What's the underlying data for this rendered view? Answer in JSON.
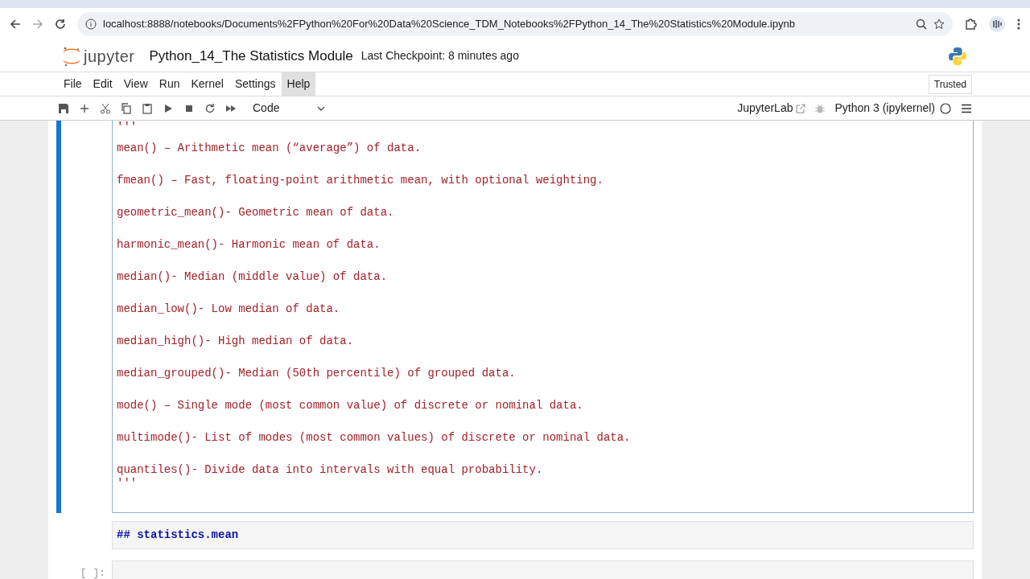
{
  "browser": {
    "url": "localhost:8888/notebooks/Documents%2FPython%20For%20Data%20Science_TDM_Notebooks%2FPython_14_The%20Statistics%20Module.ipynb"
  },
  "header": {
    "logo_text": "jupyter",
    "notebook_title": "Python_14_The Statistics Module",
    "checkpoint": "Last Checkpoint: 8 minutes ago"
  },
  "menu": {
    "items": [
      {
        "label": "File",
        "selected": false
      },
      {
        "label": "Edit",
        "selected": false
      },
      {
        "label": "View",
        "selected": false
      },
      {
        "label": "Run",
        "selected": false
      },
      {
        "label": "Kernel",
        "selected": false
      },
      {
        "label": "Settings",
        "selected": false
      },
      {
        "label": "Help",
        "selected": true
      }
    ],
    "trusted": "Trusted"
  },
  "toolbar": {
    "cell_type": "Code",
    "jupyterlab_link": "JupyterLab",
    "kernel": "Python 3 (ipykernel)"
  },
  "cells": [
    {
      "kind": "code",
      "active": true,
      "lines": [
        "'''",
        "mean() – Arithmetic mean (“average”) of data.",
        "fmean() – Fast, floating-point arithmetic mean, with optional weighting.",
        "geometric_mean()- Geometric mean of data.",
        "harmonic_mean()- Harmonic mean of data.",
        "median()- Median (middle value) of data.",
        "median_low()- Low median of data.",
        "median_high()- High median of data.",
        "median_grouped()- Median (50th percentile) of grouped data.",
        "mode() – Single mode (most common value) of discrete or nominal data.",
        "multimode()- List of modes (most common values) of discrete or nominal data.",
        "quantiles()- Divide data into intervals with equal probability.",
        "'''"
      ]
    },
    {
      "kind": "markdown",
      "active": false,
      "text": "## statistics.mean"
    },
    {
      "kind": "code",
      "active": false,
      "prompt": "[ ]:"
    }
  ]
}
